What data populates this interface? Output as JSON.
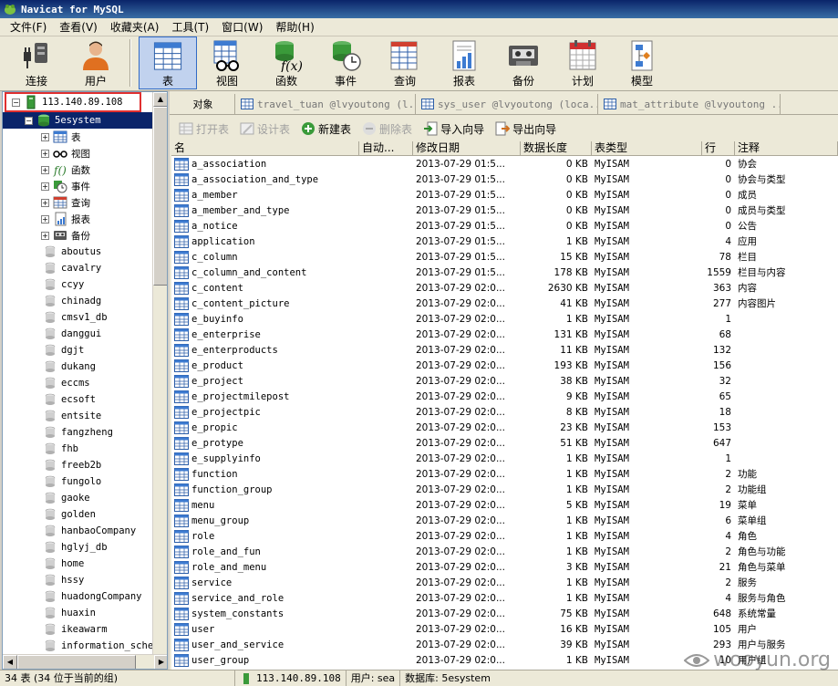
{
  "window": {
    "title": "Navicat for MySQL"
  },
  "menu": [
    "文件(F)",
    "查看(V)",
    "收藏夹(A)",
    "工具(T)",
    "窗口(W)",
    "帮助(H)"
  ],
  "toolbar": [
    {
      "label": "连接",
      "icon": "plug-icon"
    },
    {
      "label": "用户",
      "icon": "user-icon"
    },
    {
      "label": "表",
      "icon": "table-icon"
    },
    {
      "label": "视图",
      "icon": "view-icon"
    },
    {
      "label": "函数",
      "icon": "function-icon"
    },
    {
      "label": "事件",
      "icon": "event-icon"
    },
    {
      "label": "查询",
      "icon": "query-icon"
    },
    {
      "label": "报表",
      "icon": "report-icon"
    },
    {
      "label": "备份",
      "icon": "backup-icon"
    },
    {
      "label": "计划",
      "icon": "schedule-icon"
    },
    {
      "label": "模型",
      "icon": "model-icon"
    }
  ],
  "tree": {
    "connection": "113.140.89.108",
    "selected_db": "5esystem",
    "db_children": [
      "表",
      "视图",
      "函数",
      "事件",
      "查询",
      "报表",
      "备份"
    ],
    "databases": [
      "aboutus",
      "cavalry",
      "ccyy",
      "chinadg",
      "cmsv1_db",
      "danggui",
      "dgjt",
      "dukang",
      "eccms",
      "ecsoft",
      "entsite",
      "fangzheng",
      "fhb",
      "freeb2b",
      "fungolo",
      "gaoke",
      "golden",
      "hanbaoCompany",
      "hglyj_db",
      "home",
      "hssy",
      "huadongCompany",
      "huaxin",
      "ikeawarm",
      "information_schema"
    ]
  },
  "tabs": [
    {
      "label": "对象",
      "active": true
    },
    {
      "label": "travel_tuan @lvyoutong (l..."
    },
    {
      "label": "sys_user @lvyoutong (loca..."
    },
    {
      "label": "mat_attribute @lvyoutong ..."
    }
  ],
  "object_toolbar": {
    "open": "打开表",
    "design": "设计表",
    "new": "新建表",
    "delete": "删除表",
    "import": "导入向导",
    "export": "导出向导"
  },
  "grid": {
    "headers": [
      "名",
      "自动...",
      "修改日期",
      "数据长度",
      "表类型",
      "行",
      "注释"
    ],
    "rows": [
      [
        "a_association",
        "",
        "2013-07-29 01:5...",
        "0 KB",
        "MyISAM",
        "0",
        "协会"
      ],
      [
        "a_association_and_type",
        "",
        "2013-07-29 01:5...",
        "0 KB",
        "MyISAM",
        "0",
        "协会与类型"
      ],
      [
        "a_member",
        "",
        "2013-07-29 01:5...",
        "0 KB",
        "MyISAM",
        "0",
        "成员"
      ],
      [
        "a_member_and_type",
        "",
        "2013-07-29 01:5...",
        "0 KB",
        "MyISAM",
        "0",
        "成员与类型"
      ],
      [
        "a_notice",
        "",
        "2013-07-29 01:5...",
        "0 KB",
        "MyISAM",
        "0",
        "公告"
      ],
      [
        "application",
        "",
        "2013-07-29 01:5...",
        "1 KB",
        "MyISAM",
        "4",
        "应用"
      ],
      [
        "c_column",
        "",
        "2013-07-29 01:5...",
        "15 KB",
        "MyISAM",
        "78",
        "栏目"
      ],
      [
        "c_column_and_content",
        "",
        "2013-07-29 01:5...",
        "178 KB",
        "MyISAM",
        "1559",
        "栏目与内容"
      ],
      [
        "c_content",
        "",
        "2013-07-29 02:0...",
        "2630 KB",
        "MyISAM",
        "363",
        "内容"
      ],
      [
        "c_content_picture",
        "",
        "2013-07-29 02:0...",
        "41 KB",
        "MyISAM",
        "277",
        "内容图片"
      ],
      [
        "e_buyinfo",
        "",
        "2013-07-29 02:0...",
        "1 KB",
        "MyISAM",
        "1",
        ""
      ],
      [
        "e_enterprise",
        "",
        "2013-07-29 02:0...",
        "131 KB",
        "MyISAM",
        "68",
        ""
      ],
      [
        "e_enterproducts",
        "",
        "2013-07-29 02:0...",
        "11 KB",
        "MyISAM",
        "132",
        ""
      ],
      [
        "e_product",
        "",
        "2013-07-29 02:0...",
        "193 KB",
        "MyISAM",
        "156",
        ""
      ],
      [
        "e_project",
        "",
        "2013-07-29 02:0...",
        "38 KB",
        "MyISAM",
        "32",
        ""
      ],
      [
        "e_projectmilepost",
        "",
        "2013-07-29 02:0...",
        "9 KB",
        "MyISAM",
        "65",
        ""
      ],
      [
        "e_projectpic",
        "",
        "2013-07-29 02:0...",
        "8 KB",
        "MyISAM",
        "18",
        ""
      ],
      [
        "e_propic",
        "",
        "2013-07-29 02:0...",
        "23 KB",
        "MyISAM",
        "153",
        ""
      ],
      [
        "e_protype",
        "",
        "2013-07-29 02:0...",
        "51 KB",
        "MyISAM",
        "647",
        ""
      ],
      [
        "e_supplyinfo",
        "",
        "2013-07-29 02:0...",
        "1 KB",
        "MyISAM",
        "1",
        ""
      ],
      [
        "function",
        "",
        "2013-07-29 02:0...",
        "1 KB",
        "MyISAM",
        "2",
        "功能"
      ],
      [
        "function_group",
        "",
        "2013-07-29 02:0...",
        "1 KB",
        "MyISAM",
        "2",
        "功能组"
      ],
      [
        "menu",
        "",
        "2013-07-29 02:0...",
        "5 KB",
        "MyISAM",
        "19",
        "菜单"
      ],
      [
        "menu_group",
        "",
        "2013-07-29 02:0...",
        "1 KB",
        "MyISAM",
        "6",
        "菜单组"
      ],
      [
        "role",
        "",
        "2013-07-29 02:0...",
        "1 KB",
        "MyISAM",
        "4",
        "角色"
      ],
      [
        "role_and_fun",
        "",
        "2013-07-29 02:0...",
        "1 KB",
        "MyISAM",
        "2",
        "角色与功能"
      ],
      [
        "role_and_menu",
        "",
        "2013-07-29 02:0...",
        "3 KB",
        "MyISAM",
        "21",
        "角色与菜单"
      ],
      [
        "service",
        "",
        "2013-07-29 02:0...",
        "1 KB",
        "MyISAM",
        "2",
        "服务"
      ],
      [
        "service_and_role",
        "",
        "2013-07-29 02:0...",
        "1 KB",
        "MyISAM",
        "4",
        "服务与角色"
      ],
      [
        "system_constants",
        "",
        "2013-07-29 02:0...",
        "75 KB",
        "MyISAM",
        "648",
        "系统常量"
      ],
      [
        "user",
        "",
        "2013-07-29 02:0...",
        "16 KB",
        "MyISAM",
        "105",
        "用户"
      ],
      [
        "user_and_service",
        "",
        "2013-07-29 02:0...",
        "39 KB",
        "MyISAM",
        "293",
        "用户与服务"
      ],
      [
        "user_group",
        "",
        "2013-07-29 02:0...",
        "1 KB",
        "MyISAM",
        "10",
        "用户组"
      ]
    ]
  },
  "status": {
    "count": "34 表 (34 位于当前的组)",
    "host": "113.140.89.108",
    "user": "用户: sea",
    "database": "数据库: 5esystem"
  },
  "watermark": "wooyun.org"
}
